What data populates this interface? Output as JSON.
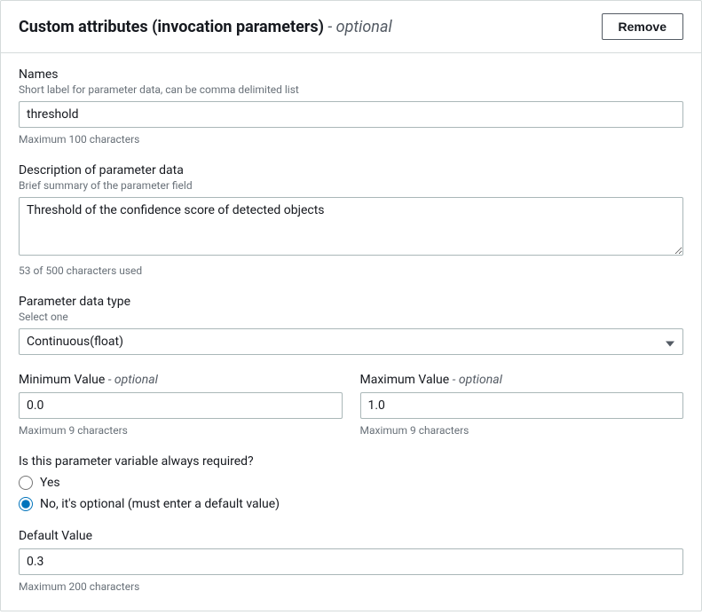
{
  "header": {
    "title": "Custom attributes (invocation parameters)",
    "optional_suffix": " - optional",
    "remove_label": "Remove"
  },
  "names": {
    "label": "Names",
    "hint": "Short label for parameter data, can be comma delimited list",
    "value": "threshold",
    "constraint": "Maximum 100 characters"
  },
  "description": {
    "label": "Description of parameter data",
    "hint": "Brief summary of the parameter field",
    "value": "Threshold of the confidence score of detected objects",
    "constraint": "53 of 500 characters used"
  },
  "datatype": {
    "label": "Parameter data type",
    "hint": "Select one",
    "value": "Continuous(float)"
  },
  "minvalue": {
    "label": "Minimum Value",
    "optional_suffix": " - optional",
    "value": "0.0",
    "constraint": "Maximum 9 characters"
  },
  "maxvalue": {
    "label": "Maximum Value",
    "optional_suffix": " - optional",
    "value": "1.0",
    "constraint": "Maximum 9 characters"
  },
  "required": {
    "label": "Is this parameter variable always required?",
    "option_yes": "Yes",
    "option_no": "No, it's optional (must enter a default value)"
  },
  "defaultvalue": {
    "label": "Default Value",
    "value": "0.3",
    "constraint": "Maximum 200 characters"
  }
}
